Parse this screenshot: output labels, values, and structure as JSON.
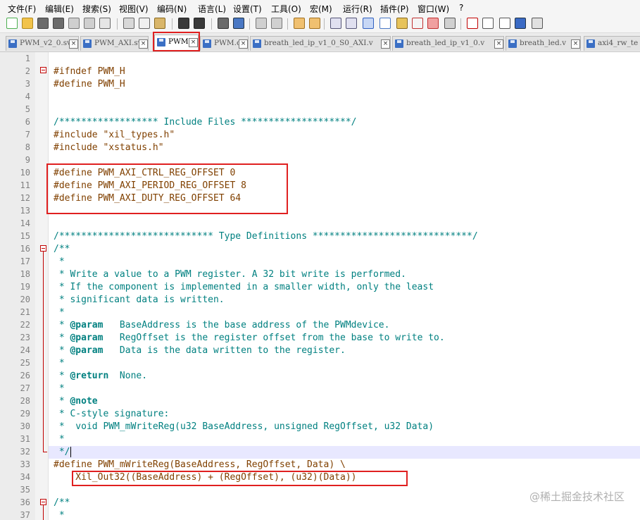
{
  "menu": [
    "文件(F)",
    "编辑(E)",
    "搜索(S)",
    "视图(V)",
    "编码(N)",
    "语言(L)",
    "设置(T)",
    "工具(O)",
    "宏(M)",
    "运行(R)",
    "插件(P)",
    "窗口(W)",
    "?"
  ],
  "tabs": [
    {
      "label": "PWM_v2_0.sv",
      "active": false
    },
    {
      "label": "PWM_AXI.sv",
      "active": false
    },
    {
      "label": "PWM.h",
      "active": true
    },
    {
      "label": "PWM.c",
      "active": false
    },
    {
      "label": "breath_led_ip_v1_0_S0_AXI.v",
      "active": false
    },
    {
      "label": "breath_led_ip_v1_0.v",
      "active": false
    },
    {
      "label": "breath_led.v",
      "active": false
    },
    {
      "label": "axi4_rw_te",
      "active": false
    }
  ],
  "close_glyph": "×",
  "lines": [
    {
      "n": "1",
      "tokens": []
    },
    {
      "n": "2",
      "tokens": [
        {
          "t": "#ifndef PWM_H",
          "c": "pre"
        }
      ]
    },
    {
      "n": "3",
      "tokens": [
        {
          "t": "#define PWM_H",
          "c": "pre"
        }
      ]
    },
    {
      "n": "4",
      "tokens": []
    },
    {
      "n": "5",
      "tokens": []
    },
    {
      "n": "6",
      "tokens": [
        {
          "t": "/****************** Include Files ********************/",
          "c": "com"
        }
      ]
    },
    {
      "n": "7",
      "tokens": [
        {
          "t": "#include ",
          "c": "pre"
        },
        {
          "t": "\"xil_types.h\"",
          "c": "pre"
        }
      ]
    },
    {
      "n": "8",
      "tokens": [
        {
          "t": "#include ",
          "c": "pre"
        },
        {
          "t": "\"xstatus.h\"",
          "c": "pre"
        }
      ]
    },
    {
      "n": "9",
      "tokens": []
    },
    {
      "n": "10",
      "tokens": [
        {
          "t": "#define PWM_AXI_CTRL_REG_OFFSET 0",
          "c": "pre"
        }
      ]
    },
    {
      "n": "11",
      "tokens": [
        {
          "t": "#define PWM_AXI_PERIOD_REG_OFFSET 8",
          "c": "pre"
        }
      ]
    },
    {
      "n": "12",
      "tokens": [
        {
          "t": "#define PWM_AXI_DUTY_REG_OFFSET 64",
          "c": "pre"
        }
      ]
    },
    {
      "n": "13",
      "tokens": []
    },
    {
      "n": "14",
      "tokens": []
    },
    {
      "n": "15",
      "tokens": [
        {
          "t": "/**************************** Type Definitions *****************************/",
          "c": "com"
        }
      ]
    },
    {
      "n": "16",
      "tokens": [
        {
          "t": "/**",
          "c": "doc"
        }
      ]
    },
    {
      "n": "17",
      "tokens": [
        {
          "t": " *",
          "c": "doc"
        }
      ]
    },
    {
      "n": "18",
      "tokens": [
        {
          "t": " * Write a value to a PWM register. A 32 bit write is performed.",
          "c": "doc"
        }
      ]
    },
    {
      "n": "19",
      "tokens": [
        {
          "t": " * If the component is implemented in a smaller width, only the least",
          "c": "doc"
        }
      ]
    },
    {
      "n": "20",
      "tokens": [
        {
          "t": " * significant data is written.",
          "c": "doc"
        }
      ]
    },
    {
      "n": "21",
      "tokens": [
        {
          "t": " *",
          "c": "doc"
        }
      ]
    },
    {
      "n": "22",
      "tokens": [
        {
          "t": " * ",
          "c": "doc"
        },
        {
          "t": "@param",
          "c": "kw"
        },
        {
          "t": "   BaseAddress is the base address of the PWMdevice.",
          "c": "doc"
        }
      ]
    },
    {
      "n": "23",
      "tokens": [
        {
          "t": " * ",
          "c": "doc"
        },
        {
          "t": "@param",
          "c": "kw"
        },
        {
          "t": "   RegOffset is the register offset from the base to write to.",
          "c": "doc"
        }
      ]
    },
    {
      "n": "24",
      "tokens": [
        {
          "t": " * ",
          "c": "doc"
        },
        {
          "t": "@param",
          "c": "kw"
        },
        {
          "t": "   Data is the data written to the register.",
          "c": "doc"
        }
      ]
    },
    {
      "n": "25",
      "tokens": [
        {
          "t": " *",
          "c": "doc"
        }
      ]
    },
    {
      "n": "26",
      "tokens": [
        {
          "t": " * ",
          "c": "doc"
        },
        {
          "t": "@return",
          "c": "kw"
        },
        {
          "t": "  None.",
          "c": "doc"
        }
      ]
    },
    {
      "n": "27",
      "tokens": [
        {
          "t": " *",
          "c": "doc"
        }
      ]
    },
    {
      "n": "28",
      "tokens": [
        {
          "t": " * ",
          "c": "doc"
        },
        {
          "t": "@note",
          "c": "kw"
        }
      ]
    },
    {
      "n": "29",
      "tokens": [
        {
          "t": " * C-style signature:",
          "c": "doc"
        }
      ]
    },
    {
      "n": "30",
      "tokens": [
        {
          "t": " *  void PWM_mWriteReg(u32 BaseAddress, unsigned RegOffset, u32 Data)",
          "c": "doc"
        }
      ]
    },
    {
      "n": "31",
      "tokens": [
        {
          "t": " *",
          "c": "doc"
        }
      ]
    },
    {
      "n": "32",
      "tokens": [
        {
          "t": " */",
          "c": "doc"
        }
      ]
    },
    {
      "n": "33",
      "tokens": [
        {
          "t": "#define PWM_mWriteReg(BaseAddress, RegOffset, Data) \\",
          "c": "pre"
        }
      ]
    },
    {
      "n": "34",
      "tokens": [
        {
          "t": "    Xil_Out32((BaseAddress) + (RegOffset), (u32)(Data))",
          "c": "pre"
        }
      ]
    },
    {
      "n": "35",
      "tokens": []
    },
    {
      "n": "36",
      "tokens": [
        {
          "t": "/**",
          "c": "doc"
        }
      ]
    },
    {
      "n": "37",
      "tokens": [
        {
          "t": " *",
          "c": "doc"
        }
      ]
    }
  ],
  "watermark": "@稀土掘金技术社区",
  "colors": {
    "annotation_red": "#e02020",
    "preprocessor": "#804000",
    "comment": "#008080",
    "current_line": "#e8e8ff"
  }
}
